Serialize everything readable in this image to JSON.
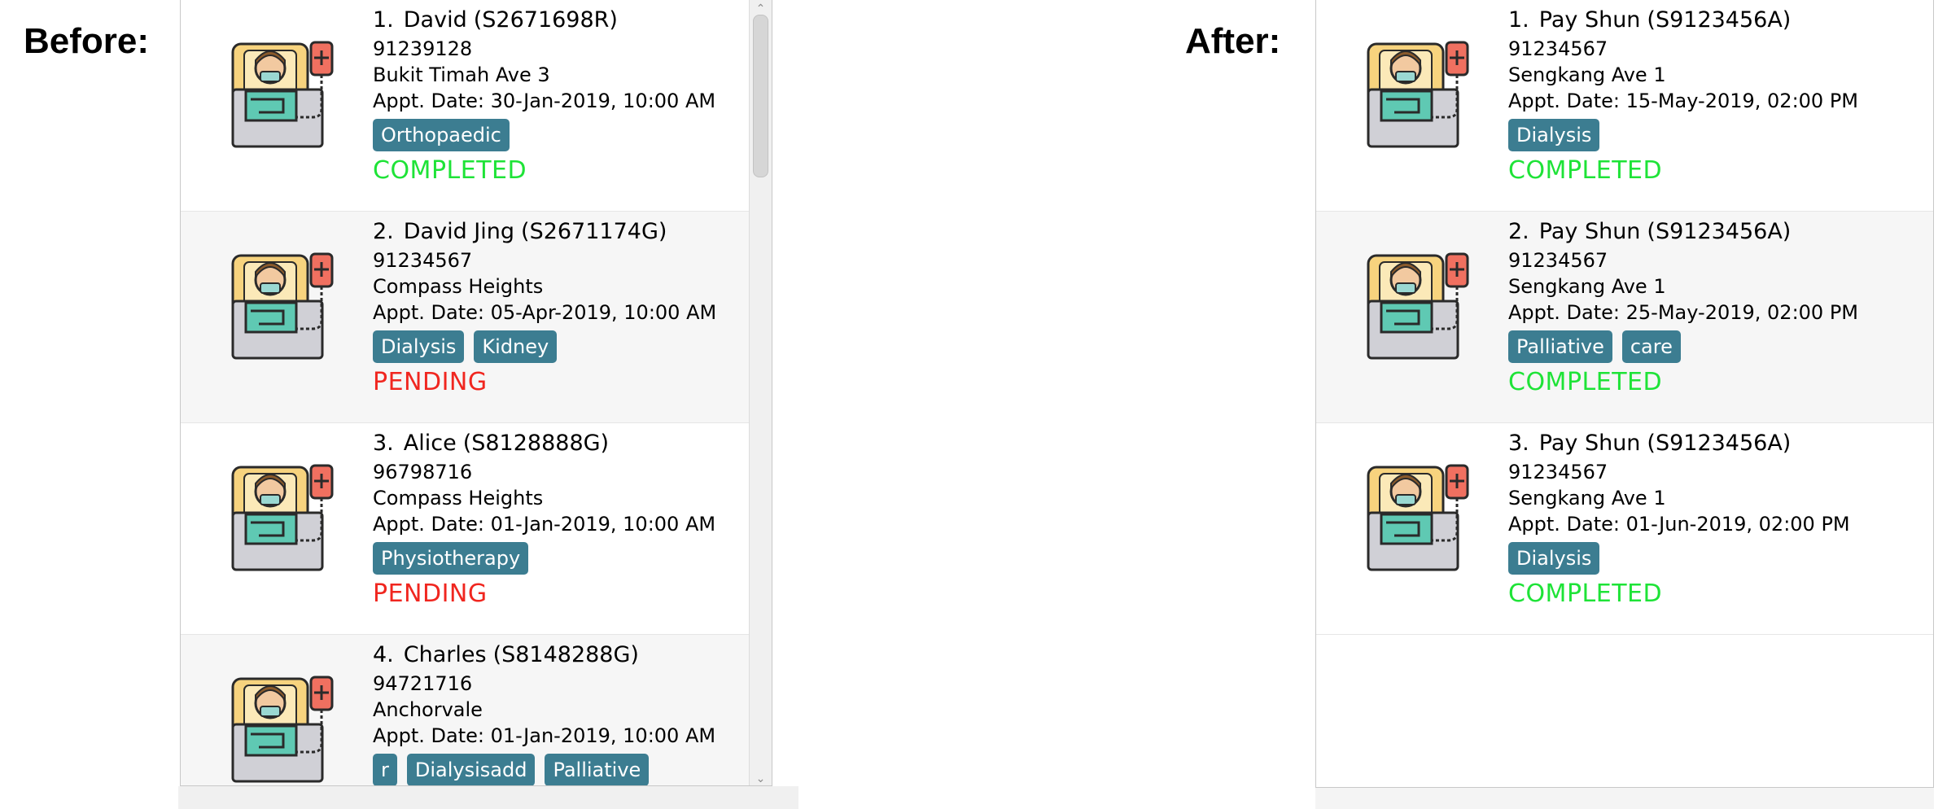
{
  "before": {
    "heading": "Before:",
    "patients": [
      {
        "index": "1.",
        "name": "David",
        "nric": "(S2671698R)",
        "phone": "91239128",
        "address": "Bukit Timah Ave 3",
        "appt": "Appt. Date: 30-Jan-2019, 10:00 AM",
        "tags": [
          "Orthopaedic"
        ],
        "status": "COMPLETED",
        "status_type": "completed",
        "icon": "patient-bed-icon"
      },
      {
        "index": "2.",
        "name": "David Jing",
        "nric": "(S2671174G)",
        "phone": "91234567",
        "address": "Compass Heights",
        "appt": "Appt. Date: 05-Apr-2019, 10:00 AM",
        "tags": [
          "Dialysis",
          "Kidney"
        ],
        "status": "PENDING",
        "status_type": "pending",
        "icon": "patient-bed-icon"
      },
      {
        "index": "3.",
        "name": "Alice",
        "nric": "(S8128888G)",
        "phone": "96798716",
        "address": "Compass Heights",
        "appt": "Appt. Date: 01-Jan-2019, 10:00 AM",
        "tags": [
          "Physiotherapy"
        ],
        "status": "PENDING",
        "status_type": "pending",
        "icon": "patient-bed-icon"
      },
      {
        "index": "4.",
        "name": "Charles",
        "nric": "(S8148288G)",
        "phone": "94721716",
        "address": "Anchorvale",
        "appt": "Appt. Date: 01-Jan-2019, 10:00 AM",
        "tags": [
          "r",
          "Dialysisadd",
          "Palliative"
        ],
        "status": "",
        "status_type": "none",
        "icon": "patient-bed-icon"
      }
    ]
  },
  "after": {
    "heading": "After:",
    "patients": [
      {
        "index": "1.",
        "name": "Pay Shun",
        "nric": "(S9123456A)",
        "phone": "91234567",
        "address": "Sengkang Ave 1",
        "appt": "Appt. Date: 15-May-2019, 02:00 PM",
        "tags": [
          "Dialysis"
        ],
        "status": "COMPLETED",
        "status_type": "completed",
        "icon": "patient-bed-icon"
      },
      {
        "index": "2.",
        "name": "Pay Shun",
        "nric": "(S9123456A)",
        "phone": "91234567",
        "address": "Sengkang Ave 1",
        "appt": "Appt. Date: 25-May-2019, 02:00 PM",
        "tags": [
          "Palliative",
          "care"
        ],
        "status": "COMPLETED",
        "status_type": "completed",
        "icon": "patient-bed-icon"
      },
      {
        "index": "3.",
        "name": "Pay Shun",
        "nric": "(S9123456A)",
        "phone": "91234567",
        "address": "Sengkang Ave 1",
        "appt": "Appt. Date: 01-Jun-2019, 02:00 PM",
        "tags": [
          "Dialysis"
        ],
        "status": "COMPLETED",
        "status_type": "completed",
        "icon": "patient-bed-icon"
      }
    ]
  },
  "colors": {
    "tag_bg": "#3c7d91",
    "completed": "#1ee337",
    "pending": "#f0261f"
  }
}
